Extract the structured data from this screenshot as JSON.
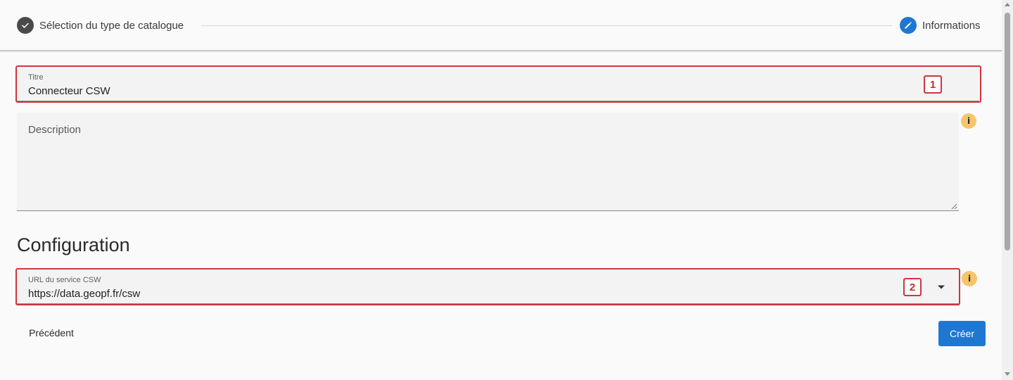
{
  "stepper": {
    "step1_label": "Sélection du type de catalogue",
    "step2_label": "Informations",
    "step1_icon": "check-icon",
    "step2_icon": "pencil-icon"
  },
  "form": {
    "title_field": {
      "label": "Titre",
      "value": "Connecteur CSW"
    },
    "description_field": {
      "placeholder": "Description"
    },
    "section_title": "Configuration",
    "url_field": {
      "label": "URL du service CSW",
      "value": "https://data.geopf.fr/csw"
    }
  },
  "annotations": {
    "marker1": "1",
    "marker2": "2"
  },
  "info_icon_glyph": "i",
  "buttons": {
    "previous": "Précédent",
    "create": "Créer"
  },
  "colors": {
    "primary": "#1e78d2",
    "highlight": "#d0343c",
    "info": "#f6c56a",
    "completed_step": "#4a4a4a"
  }
}
